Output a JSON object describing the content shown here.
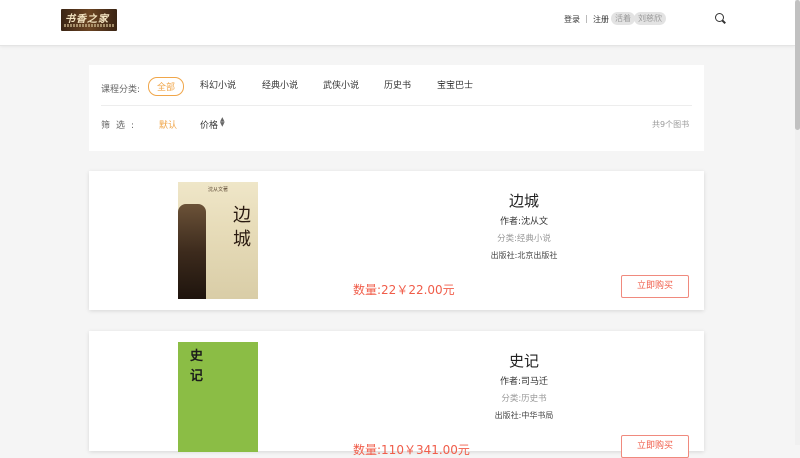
{
  "header": {
    "logo_text": "书香之家",
    "login": "登录",
    "separator": "|",
    "register": "注册",
    "search_tags": [
      "活着",
      "刘慈欣"
    ]
  },
  "filters": {
    "category_label": "课程分类:",
    "categories": [
      "全部",
      "科幻小说",
      "经典小说",
      "武侠小说",
      "历史书",
      "宝宝巴士"
    ],
    "active_category": "全部",
    "sort_label": "筛选:",
    "sort_default": "默认",
    "sort_price": "价格",
    "count_text": "共9个图书"
  },
  "books": [
    {
      "cover_title": "边城",
      "cover_subtitle": "沈从文著",
      "title": "边城",
      "author": "作者:沈从文",
      "category": "分类:经典小说",
      "publisher": "出版社:北京出版社",
      "price": "数量:22￥22.00元",
      "buy_label": "立即购买"
    },
    {
      "cover_title": "史记",
      "title": "史记",
      "author": "作者:司马迁",
      "category": "分类:历史书",
      "publisher": "出版社:中华书局",
      "price": "数量:110￥341.00元",
      "buy_label": "立即购买"
    }
  ],
  "colors": {
    "accent": "#f0a64a",
    "price": "#f05d4a"
  }
}
